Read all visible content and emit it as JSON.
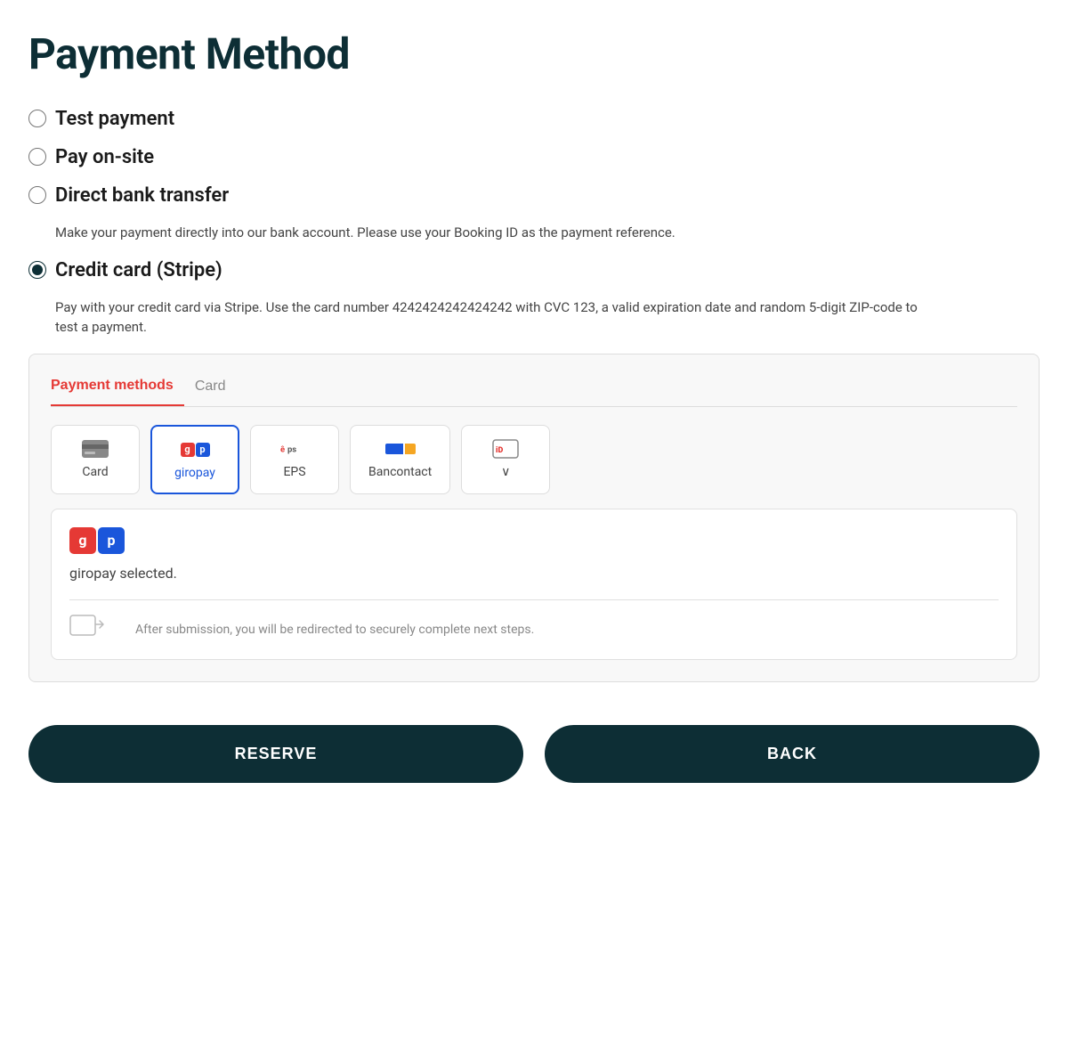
{
  "page": {
    "title": "Payment Method"
  },
  "payment_options": [
    {
      "id": "test",
      "label": "Test payment",
      "checked": false,
      "description": ""
    },
    {
      "id": "onsite",
      "label": "Pay on-site",
      "checked": false,
      "description": ""
    },
    {
      "id": "bank",
      "label": "Direct bank transfer",
      "checked": false,
      "description": "Make your payment directly into our bank account. Please use your Booking ID as the payment reference."
    },
    {
      "id": "stripe",
      "label": "Credit card (Stripe)",
      "checked": true,
      "description": "Pay with your credit card via Stripe. Use the card number 4242424242424242 with CVC 123, a valid expiration date and random 5-digit ZIP-code to test a payment."
    }
  ],
  "stripe": {
    "tabs": [
      {
        "id": "payment_methods",
        "label": "Payment methods",
        "active": true
      },
      {
        "id": "card",
        "label": "Card",
        "active": false
      }
    ],
    "methods": [
      {
        "id": "card",
        "label": "Card",
        "selected": false
      },
      {
        "id": "giropay",
        "label": "giropay",
        "selected": true
      },
      {
        "id": "eps",
        "label": "EPS",
        "selected": false
      },
      {
        "id": "bancontact",
        "label": "Bancontact",
        "selected": false
      },
      {
        "id": "more",
        "label": "∨",
        "selected": false
      }
    ],
    "selected_method": {
      "name": "giropay",
      "selected_text": "giropay selected.",
      "redirect_text": "After submission, you will be redirected to securely complete next steps."
    }
  },
  "buttons": {
    "reserve": "RESERVE",
    "back": "BACK"
  }
}
